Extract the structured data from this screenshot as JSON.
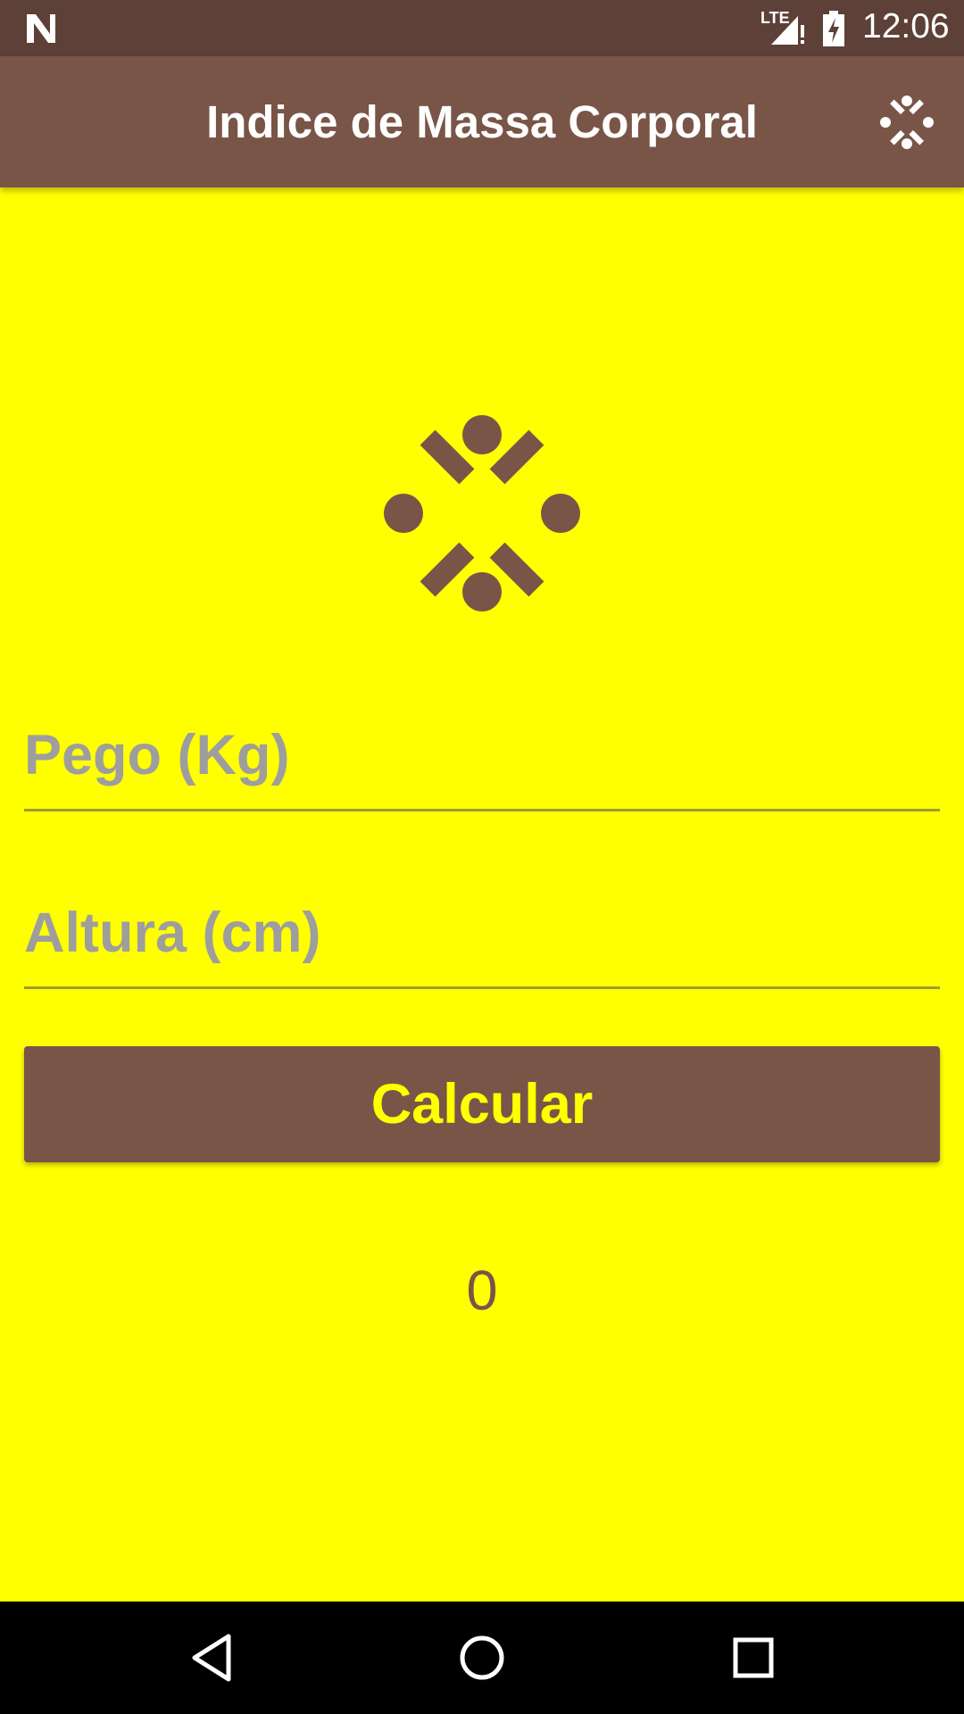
{
  "status_bar": {
    "time": "12:06",
    "network": "LTE",
    "icons": [
      "n-logo-icon",
      "signal-icon",
      "battery-charging-icon"
    ]
  },
  "app_bar": {
    "title": "Indice de Massa Corporal",
    "menu_icon": "dots-ring-icon"
  },
  "hero": {
    "icon": "dots-ring-icon"
  },
  "form": {
    "weight": {
      "placeholder": "Pego (Kg)",
      "value": ""
    },
    "height": {
      "placeholder": "Altura (cm)",
      "value": ""
    },
    "calculate_label": "Calcular"
  },
  "result": {
    "value": "0"
  },
  "nav_bar": {
    "icons": [
      "back-icon",
      "home-icon",
      "recents-icon"
    ]
  },
  "colors": {
    "background": "#ffff00",
    "app_bar": "#795548",
    "status_bar": "#5d4037",
    "button_text": "#ffff00",
    "placeholder": "#9e9e9e"
  }
}
